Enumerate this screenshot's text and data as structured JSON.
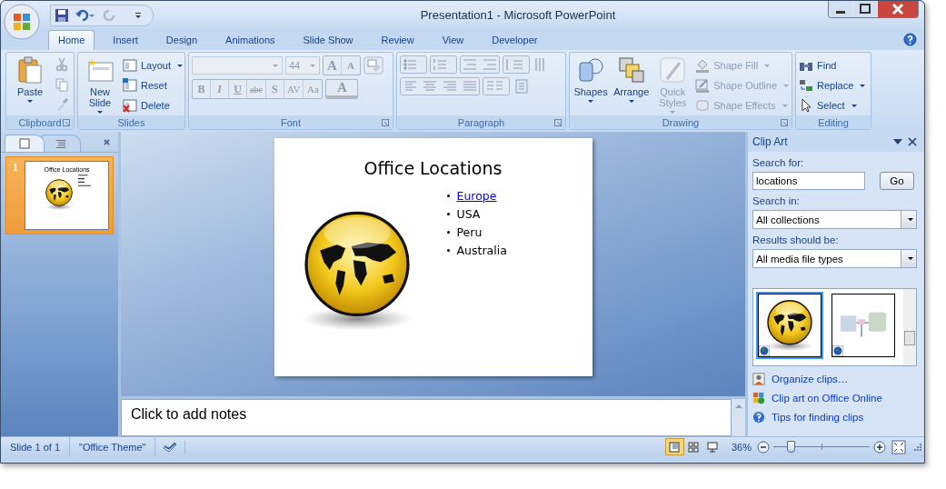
{
  "window": {
    "title": "Presentation1 - Microsoft PowerPoint"
  },
  "tabs": [
    {
      "label": "Home",
      "selected": true
    },
    {
      "label": "Insert",
      "selected": false
    },
    {
      "label": "Design",
      "selected": false
    },
    {
      "label": "Animations",
      "selected": false
    },
    {
      "label": "Slide Show",
      "selected": false
    },
    {
      "label": "Review",
      "selected": false
    },
    {
      "label": "View",
      "selected": false
    },
    {
      "label": "Developer",
      "selected": false
    }
  ],
  "ribbon": {
    "clipboard": {
      "title": "Clipboard",
      "paste": "Paste"
    },
    "slides": {
      "title": "Slides",
      "new_slide": "New Slide",
      "commands": [
        {
          "kind": "layout",
          "label": "Layout"
        },
        {
          "kind": "reset",
          "label": "Reset"
        },
        {
          "kind": "delete",
          "label": "Delete"
        }
      ]
    },
    "font": {
      "title": "Font",
      "size": "44",
      "disabled": true,
      "grow": "A",
      "shrink": "A",
      "font_color_letter": "A",
      "formats": [
        {
          "kind": "bold",
          "label": "B"
        },
        {
          "kind": "italic",
          "label": "I"
        },
        {
          "kind": "underline",
          "label": "U"
        },
        {
          "kind": "strike",
          "label": "abc"
        },
        {
          "kind": "shadow",
          "label": "S"
        },
        {
          "kind": "spacing",
          "label": "AV"
        },
        {
          "kind": "case",
          "label": "Aa"
        }
      ]
    },
    "paragraph": {
      "title": "Paragraph",
      "disabled": true
    },
    "drawing": {
      "title": "Drawing",
      "large": [
        {
          "kind": "shapes",
          "label": "Shapes",
          "disabled": false
        },
        {
          "kind": "arrange",
          "label": "Arrange",
          "disabled": false
        },
        {
          "kind": "styles",
          "label": "Quick Styles",
          "disabled": true
        }
      ],
      "commands": [
        {
          "kind": "fill",
          "label": "Shape Fill",
          "disabled": true
        },
        {
          "kind": "outline",
          "label": "Shape Outline",
          "disabled": true
        },
        {
          "kind": "effects",
          "label": "Shape Effects",
          "disabled": true
        }
      ]
    },
    "editing": {
      "title": "Editing",
      "commands": [
        {
          "kind": "find",
          "label": "Find"
        },
        {
          "kind": "replace",
          "label": "Replace"
        },
        {
          "kind": "select",
          "label": "Select"
        }
      ]
    }
  },
  "slides_pane": {
    "tabs": [
      {
        "kind": "slides",
        "selected": true
      },
      {
        "kind": "outline",
        "selected": false
      }
    ],
    "thumbnails": [
      {
        "number": "1",
        "title": "Office Locations",
        "selected": true
      }
    ]
  },
  "slide": {
    "title": "Office Locations",
    "bullets": [
      {
        "text": "Europe",
        "link": true
      },
      {
        "text": "USA",
        "link": false
      },
      {
        "text": "Peru",
        "link": false
      },
      {
        "text": "Australia",
        "link": false
      }
    ]
  },
  "notes": {
    "placeholder": "Click to add notes"
  },
  "clip_art": {
    "title": "Clip Art",
    "search_label": "Search for:",
    "search_value": "locations",
    "go": "Go",
    "search_in_label": "Search in:",
    "search_in": "All collections",
    "results_label": "Results should be:",
    "results": "All media file types",
    "clips": [
      {
        "kind": "globe",
        "selected": true
      },
      {
        "kind": "diagram",
        "selected": false
      }
    ],
    "links": [
      {
        "kind": "organize",
        "label": "Organize clips…"
      },
      {
        "kind": "online",
        "label": "Clip art on Office Online"
      },
      {
        "kind": "tips",
        "label": "Tips for finding clips"
      }
    ]
  },
  "status_bar": {
    "slide": "Slide 1 of 1",
    "theme": "\"Office Theme\"",
    "views": [
      {
        "kind": "normal",
        "selected": true
      },
      {
        "kind": "sorter",
        "selected": false
      },
      {
        "kind": "show",
        "selected": false
      }
    ],
    "zoom": "36%",
    "zoom_slider": {
      "level": 0.17
    }
  }
}
